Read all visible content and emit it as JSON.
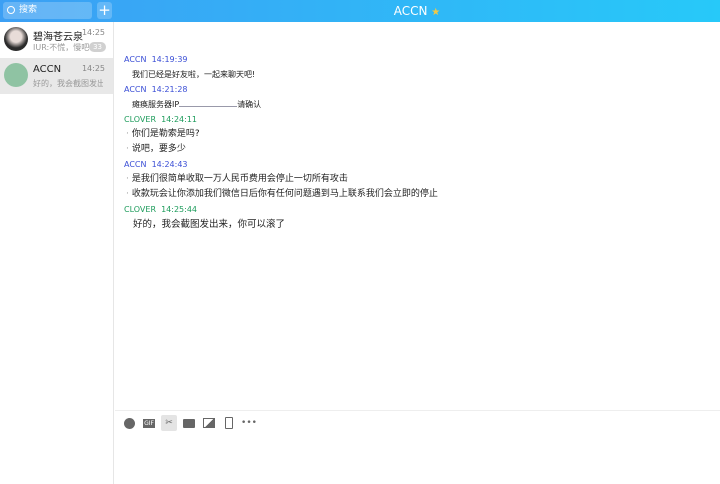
{
  "header": {
    "search_placeholder": "搜索",
    "add_label": "+",
    "title": "ACCN"
  },
  "conversations": [
    {
      "name": "碧海苍云泉",
      "time": "14:25",
      "preview": "IUR:不慌，慢吧",
      "badge": "33"
    },
    {
      "name": "ACCN",
      "time": "14:25",
      "preview": "好的，我会截图发出来"
    }
  ],
  "messages": [
    {
      "sender": "ACCN",
      "time": "14:19:39",
      "kind": "a",
      "lines": [
        "我们已经是好友啦，一起来聊天吧!"
      ],
      "style": "plain"
    },
    {
      "sender": "ACCN",
      "time": "14:21:28",
      "kind": "a",
      "lines": [
        "瘫痪服务器IP",
        "请确认"
      ],
      "style": "redact"
    },
    {
      "sender": "CLOVER",
      "time": "14:24:11",
      "kind": "c",
      "lines": [
        "你们是勒索是吗?",
        "说吧，要多少"
      ],
      "style": "bullet"
    },
    {
      "sender": "ACCN",
      "time": "14:24:43",
      "kind": "a",
      "lines": [
        "是我们很简单收取一万人民币费用会停止一切所有攻击",
        "收款玩会让你添加我们微信日后你有任何问题遇到马上联系我们会立即的停止"
      ],
      "style": "bullet"
    },
    {
      "sender": "CLOVER",
      "time": "14:25:44",
      "kind": "c",
      "lines": [
        "好的，我会截图发出来，你可以滚了"
      ],
      "style": "big"
    }
  ],
  "toolbar": {
    "icons": [
      "emoji-icon",
      "gif-icon",
      "scissors-icon",
      "folder-icon",
      "image-icon",
      "shake-icon",
      "more-icon"
    ],
    "gif_label": "GIF",
    "more_label": "•••"
  },
  "colors": {
    "accn": "#3b4fd6",
    "clover": "#1e9c5c"
  }
}
